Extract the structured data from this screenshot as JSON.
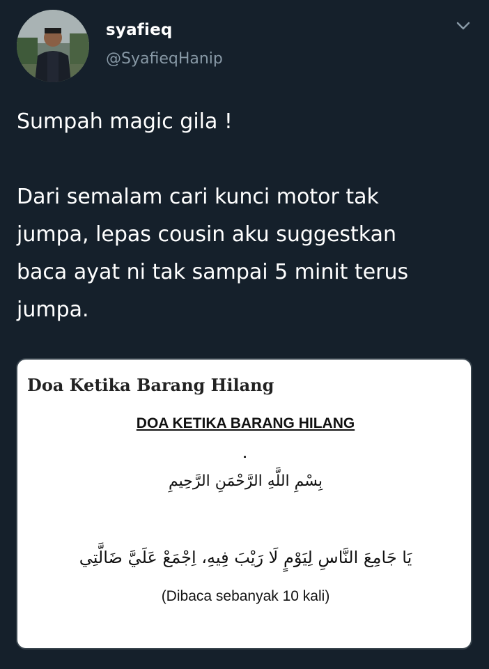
{
  "tweet": {
    "author": {
      "display_name": "syafieq",
      "handle": "@SyafieqHanip",
      "avatar_icon": "profile-photo"
    },
    "menu_icon": "chevron-down-icon",
    "text_lines": [
      "Sumpah magic gila !",
      "Dari semalam cari kunci motor tak",
      "jumpa, lepas cousin aku suggestkan",
      "baca ayat ni tak sampai 5 minit terus",
      "jumpa."
    ],
    "card": {
      "title": "Doa Ketika Barang Hilang",
      "heading": "DOA KETIKA BARANG HILANG",
      "basmala": "بِسْمِ اللَّهِ الرَّحْمَنِ الرَّحِيمِ",
      "doa": "يَا جَامِعَ النَّاسِ لِيَوْمٍ لَا رَيْبَ فِيهِ، اِجْمَعْ عَلَيَّ ضَالَّتِي",
      "note": "(Dibaca sebanyak 10 kali)"
    }
  },
  "colors": {
    "background": "#15202b",
    "secondary_text": "#8899a6",
    "card_background": "#ffffff"
  }
}
